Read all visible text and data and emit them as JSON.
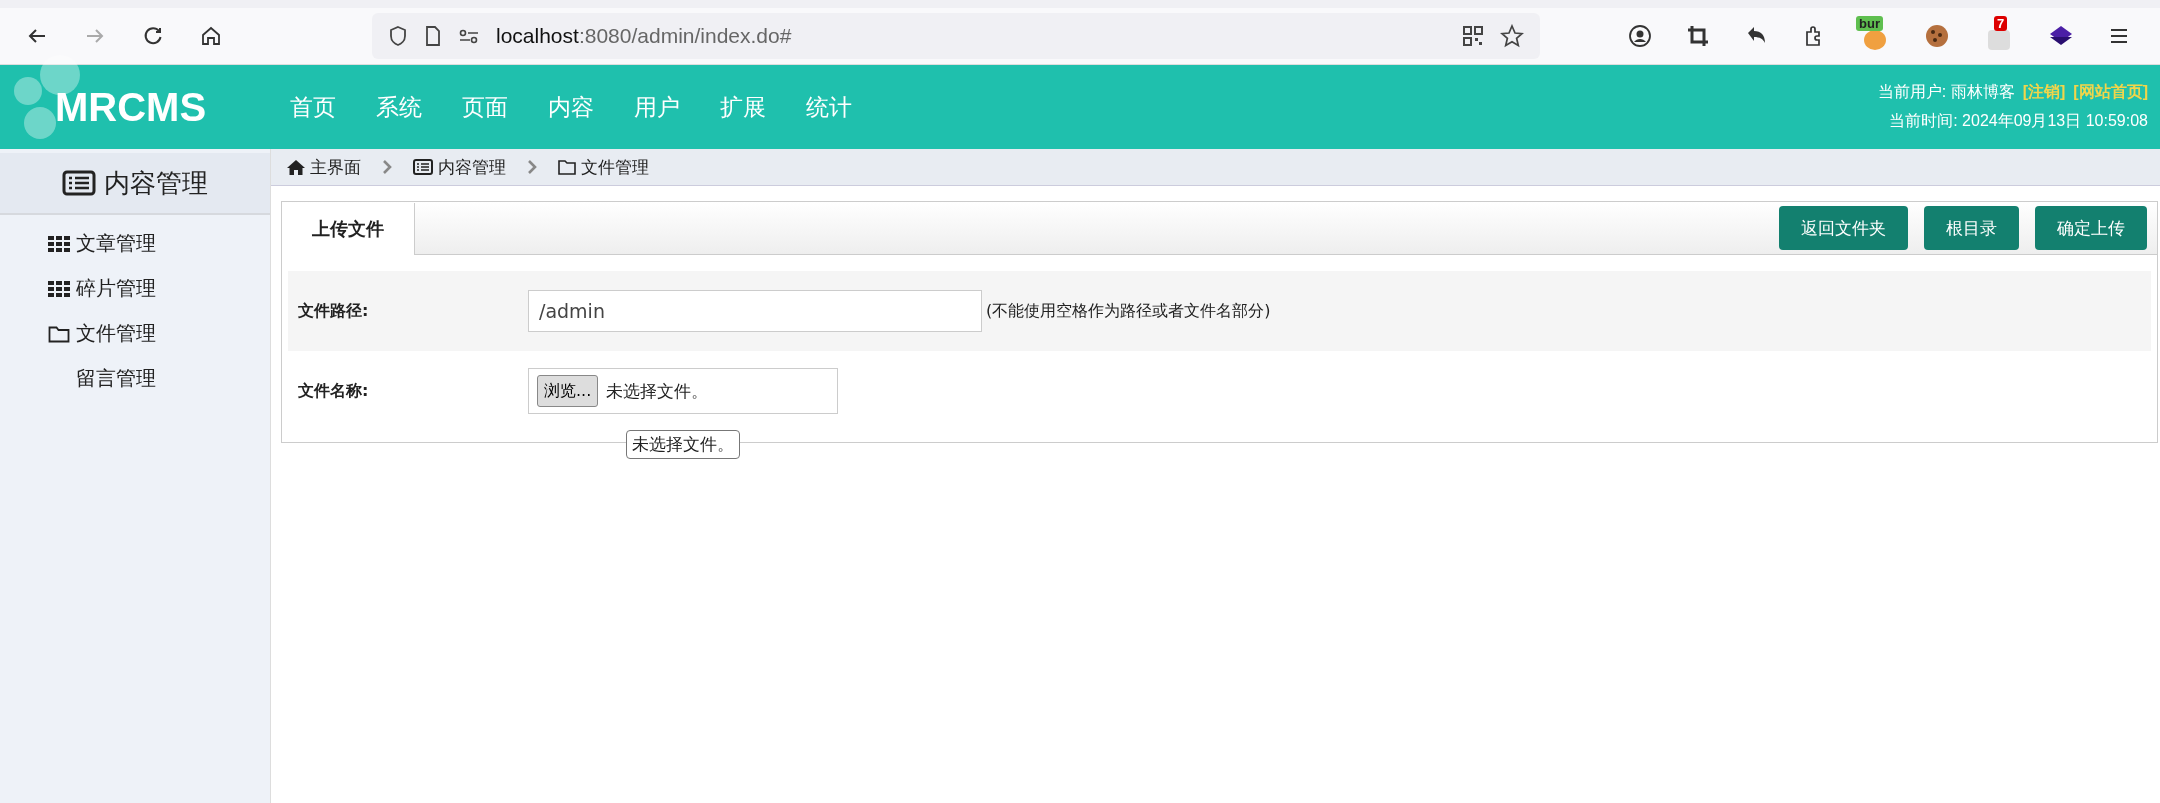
{
  "browser": {
    "url_host": "localhost",
    "url_rest": ":8080/admin/index.do#",
    "extensions": [
      {
        "kind": "bur",
        "badge": "bur"
      },
      {
        "kind": "cookie"
      },
      {
        "kind": "counter",
        "badge": "7"
      },
      {
        "kind": "layers"
      }
    ]
  },
  "header": {
    "logo": "MRCMS",
    "nav": [
      "首页",
      "系统",
      "页面",
      "内容",
      "用户",
      "扩展",
      "统计"
    ],
    "user": "当前用户: 雨林博客",
    "links": [
      "[注销]",
      "[网站首页]"
    ],
    "time": "当前时间: 2024年09月13日 10:59:08"
  },
  "sidebar": {
    "title": "内容管理",
    "items": [
      {
        "label": "文章管理",
        "kind": "grid"
      },
      {
        "label": "碎片管理",
        "kind": "grid"
      },
      {
        "label": "文件管理",
        "kind": "folder"
      },
      {
        "label": "留言管理",
        "kind": "plain"
      }
    ]
  },
  "breadcrumb": [
    {
      "label": "主界面",
      "kind": "home"
    },
    {
      "label": "内容管理",
      "kind": "list"
    },
    {
      "label": "文件管理",
      "kind": "folder"
    }
  ],
  "panel": {
    "tabs": [
      {
        "label": "上传文件",
        "selected": true
      }
    ],
    "buttons": [
      "返回文件夹",
      "根目录",
      "确定上传"
    ],
    "path_label": "文件路径:",
    "path_value": "/admin",
    "path_hint": "(不能使用空格作为路径或者文件名部分)",
    "name_label": "文件名称:",
    "browse_button": "浏览...",
    "no_file": "未选择文件。",
    "tooltip": "未选择文件。"
  }
}
